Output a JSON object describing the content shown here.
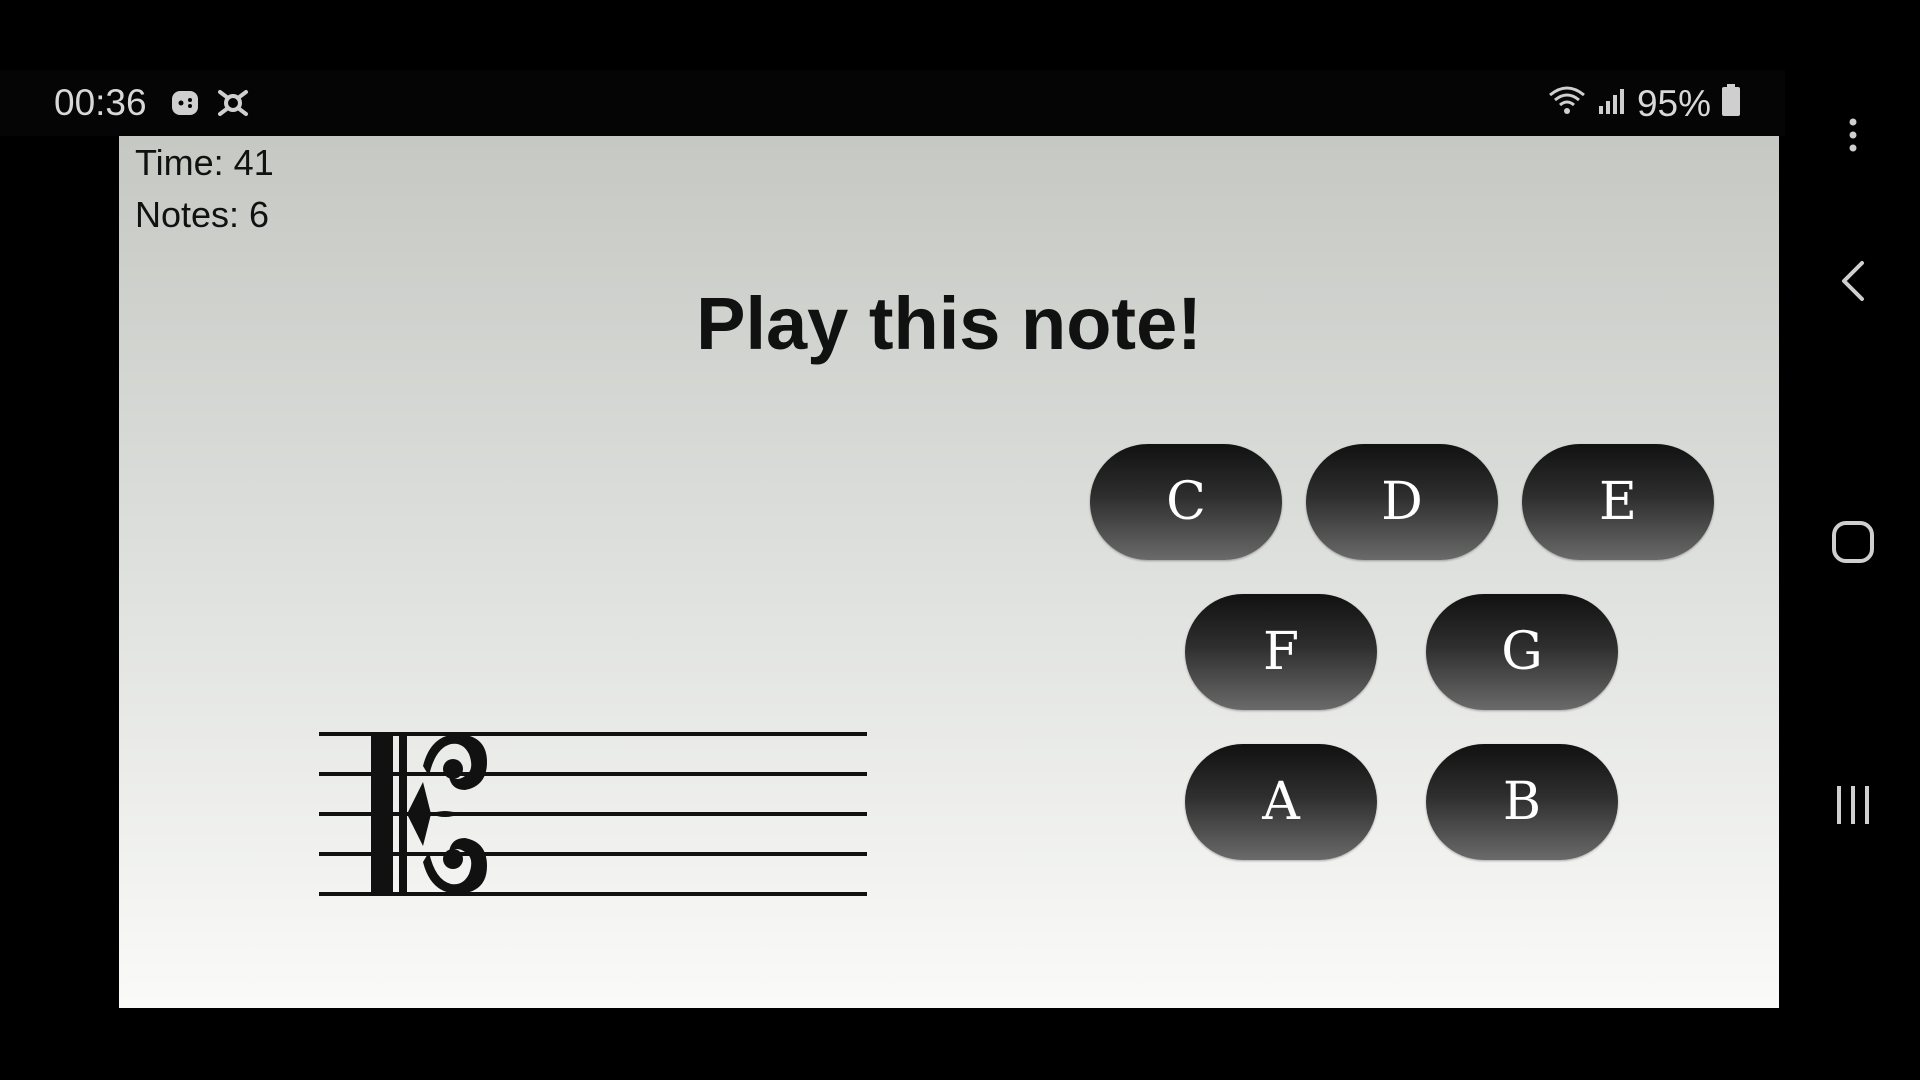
{
  "status_bar": {
    "time": "00:36",
    "left_icons": [
      "game-controller-icon",
      "bug-icon"
    ],
    "right_icons": [
      "wifi-icon",
      "signal-icon",
      "battery-icon"
    ],
    "battery": "95%"
  },
  "game": {
    "time_label": "Time: 41",
    "notes_label": "Notes: 6",
    "title": "Play this note!",
    "clef": "alto-clef",
    "buttons": {
      "c": "C",
      "d": "D",
      "e": "E",
      "f": "F",
      "g": "G",
      "a": "A",
      "b": "B"
    }
  },
  "nav_bar": {
    "items": [
      "more-options-icon",
      "back-icon",
      "home-icon",
      "recents-icon"
    ]
  },
  "colors": {
    "button_top": "#111111",
    "button_bottom": "#6a6a6a",
    "background_top": "#c6c8c4",
    "background_bottom": "#fafaf9"
  }
}
